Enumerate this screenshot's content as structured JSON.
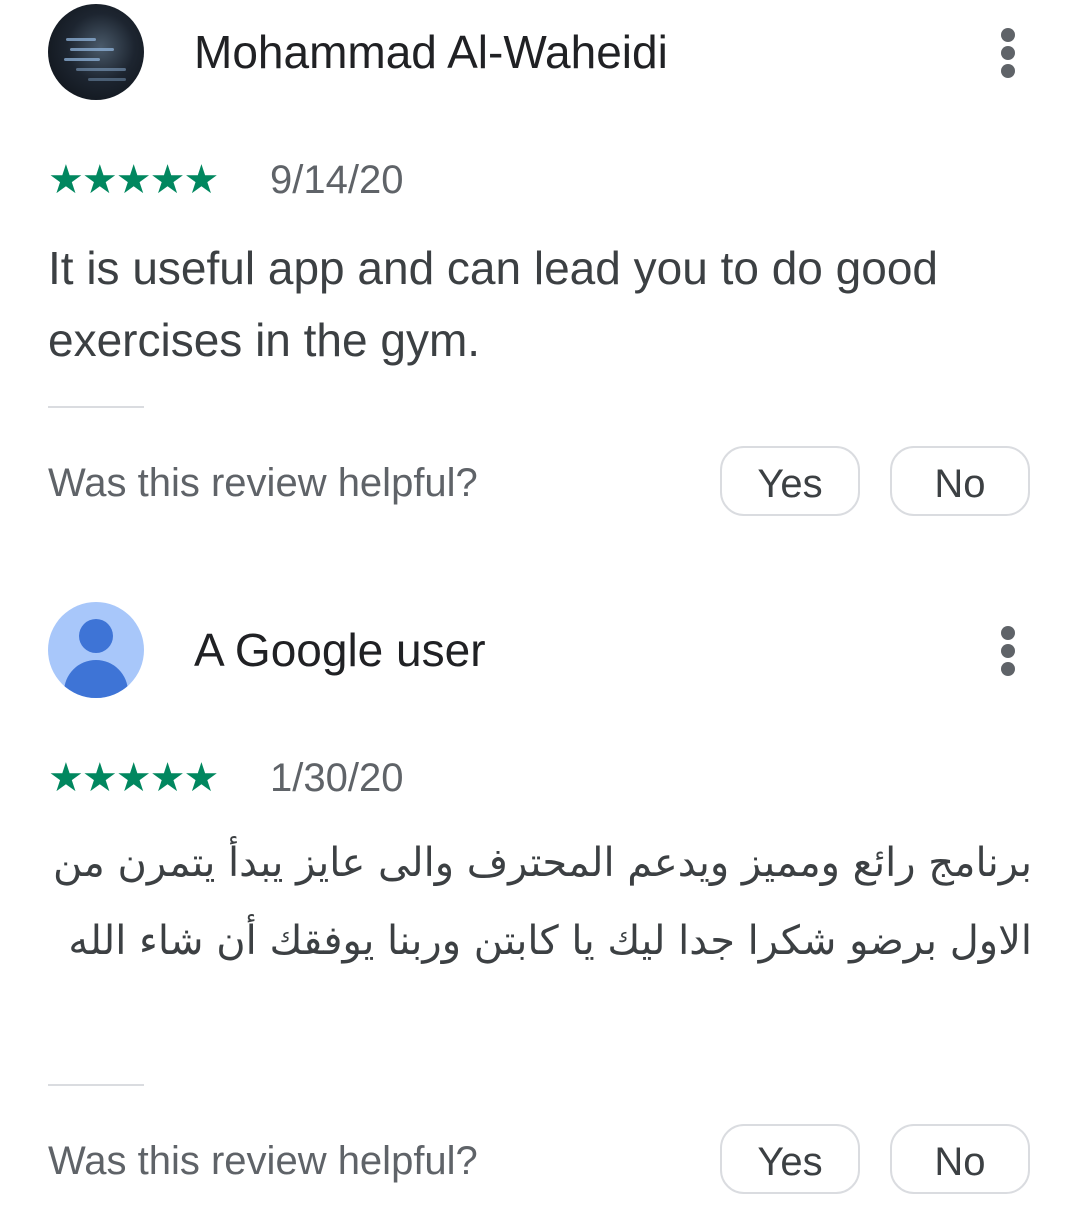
{
  "reviews": [
    {
      "author": "Mohammad Al-Waheidi",
      "avatar": "photo-avatar",
      "rating": 5,
      "stars": "★★★★★",
      "date": "9/14/20",
      "text": "It is useful app and can lead you to do good exercises in the gym.",
      "helpful_prompt": "Was this review helpful?",
      "yes_label": "Yes",
      "no_label": "No"
    },
    {
      "author": "A Google user",
      "avatar": "default-user-avatar",
      "rating": 5,
      "stars": "★★★★★",
      "date": "1/30/20",
      "text": "برنامج رائع ومميز ويدعم المحترف والى عايز يبدأ يتمرن من الاول برضو شكرا جدا ليك يا كابتن وربنا يوفقك أن شاء الله",
      "helpful_prompt": "Was this review helpful?",
      "yes_label": "Yes",
      "no_label": "No"
    }
  ],
  "colors": {
    "star": "#01875f",
    "text": "#3c4043",
    "secondary": "#5f6368",
    "border": "#dadce0",
    "avatar_default_bg": "#a8c7fa",
    "avatar_default_fg": "#3e74d6"
  },
  "icons": {
    "more": "more-vert-icon",
    "star": "star-icon"
  }
}
